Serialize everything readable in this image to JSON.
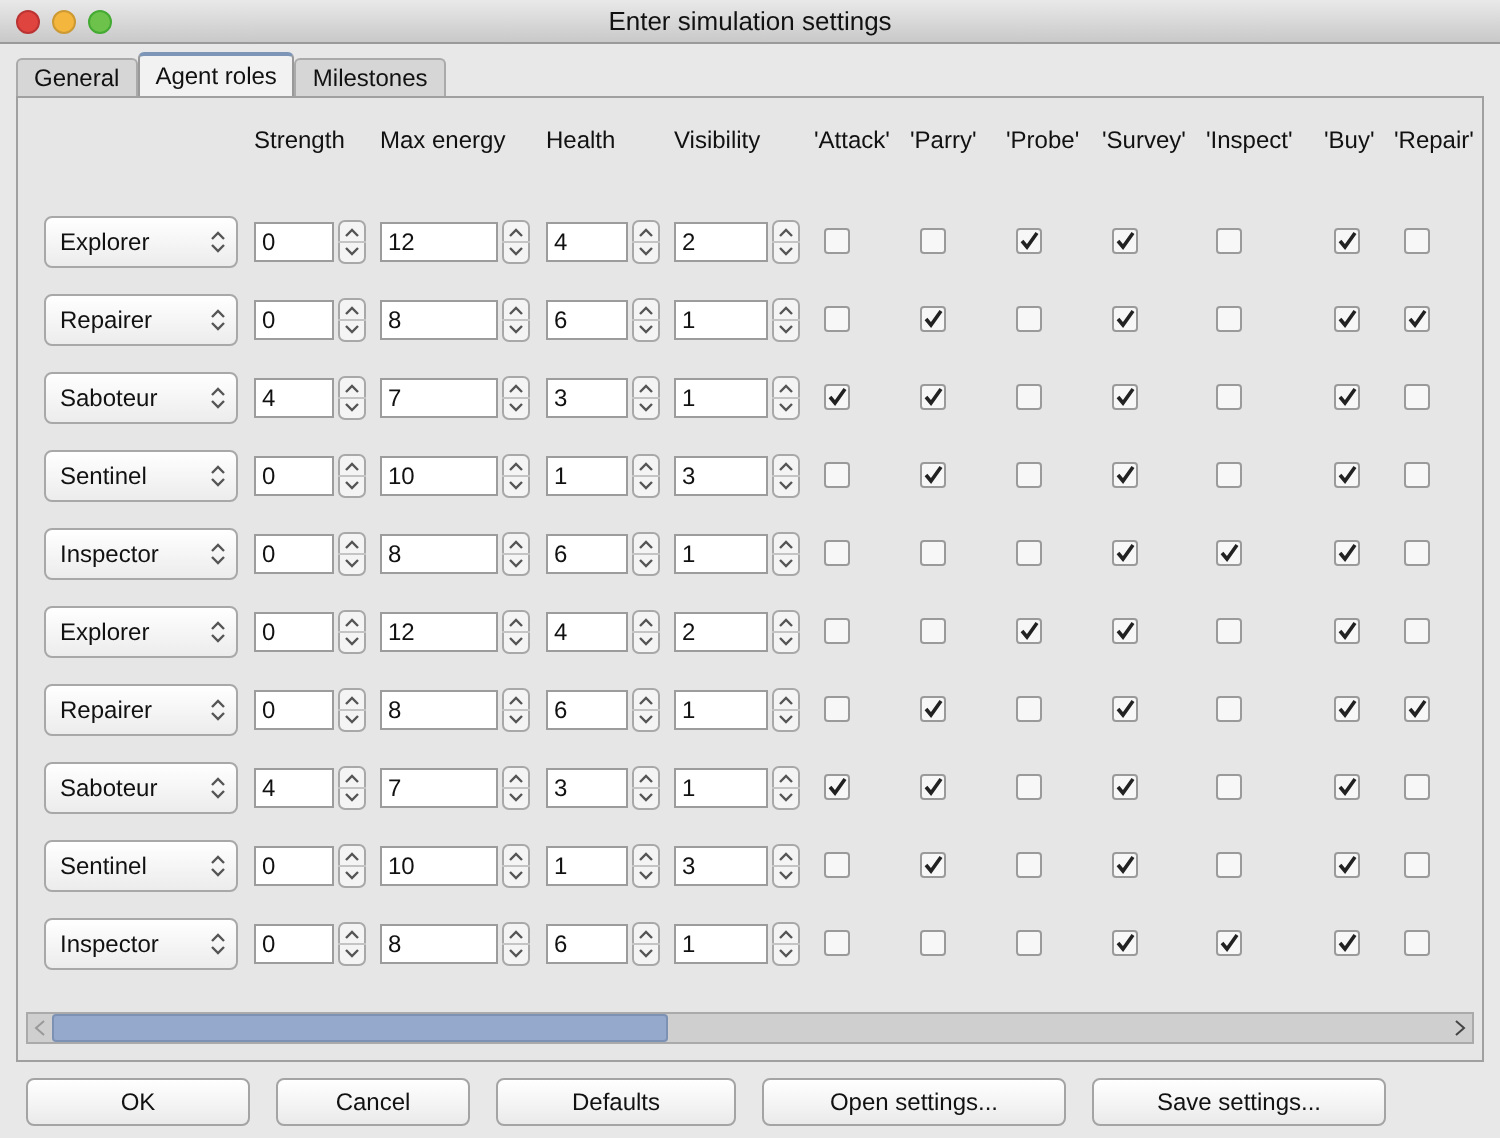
{
  "window": {
    "title": "Enter simulation settings"
  },
  "tabs": [
    {
      "label": "General",
      "selected": false
    },
    {
      "label": "Agent roles",
      "selected": true
    },
    {
      "label": "Milestones",
      "selected": false
    }
  ],
  "table": {
    "columns": [
      "Strength",
      "Max energy",
      "Health",
      "Visibility",
      "'Attack'",
      "'Parry'",
      "'Probe'",
      "'Survey'",
      "'Inspect'",
      "'Buy'",
      "'Repair'"
    ],
    "rows": [
      {
        "role": "Explorer",
        "values": [
          "0",
          "12",
          "4",
          "2"
        ],
        "actions": [
          false,
          false,
          true,
          true,
          false,
          true,
          false
        ]
      },
      {
        "role": "Repairer",
        "values": [
          "0",
          "8",
          "6",
          "1"
        ],
        "actions": [
          false,
          true,
          false,
          true,
          false,
          true,
          true
        ]
      },
      {
        "role": "Saboteur",
        "values": [
          "4",
          "7",
          "3",
          "1"
        ],
        "actions": [
          true,
          true,
          false,
          true,
          false,
          true,
          false
        ]
      },
      {
        "role": "Sentinel",
        "values": [
          "0",
          "10",
          "1",
          "3"
        ],
        "actions": [
          false,
          true,
          false,
          true,
          false,
          true,
          false
        ]
      },
      {
        "role": "Inspector",
        "values": [
          "0",
          "8",
          "6",
          "1"
        ],
        "actions": [
          false,
          false,
          false,
          true,
          true,
          true,
          false
        ]
      },
      {
        "role": "Explorer",
        "values": [
          "0",
          "12",
          "4",
          "2"
        ],
        "actions": [
          false,
          false,
          true,
          true,
          false,
          true,
          false
        ]
      },
      {
        "role": "Repairer",
        "values": [
          "0",
          "8",
          "6",
          "1"
        ],
        "actions": [
          false,
          true,
          false,
          true,
          false,
          true,
          true
        ]
      },
      {
        "role": "Saboteur",
        "values": [
          "4",
          "7",
          "3",
          "1"
        ],
        "actions": [
          true,
          true,
          false,
          true,
          false,
          true,
          false
        ]
      },
      {
        "role": "Sentinel",
        "values": [
          "0",
          "10",
          "1",
          "3"
        ],
        "actions": [
          false,
          true,
          false,
          true,
          false,
          true,
          false
        ]
      },
      {
        "role": "Inspector",
        "values": [
          "0",
          "8",
          "6",
          "1"
        ],
        "actions": [
          false,
          false,
          false,
          true,
          true,
          true,
          false
        ]
      }
    ]
  },
  "buttons": [
    "OK",
    "Cancel",
    "Defaults",
    "Open settings...",
    "Save settings..."
  ]
}
